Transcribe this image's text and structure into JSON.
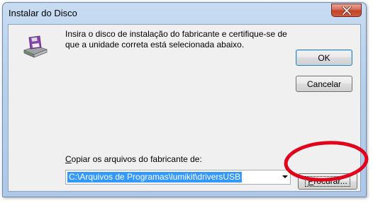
{
  "window": {
    "title": "Instalar do Disco"
  },
  "message": {
    "text": "Insira o disco de instalação do fabricante e certifique-se de que a unidade correta está selecionada abaixo."
  },
  "buttons": {
    "ok_label": "OK",
    "cancel_label": "Cancelar",
    "browse_prefix": "P",
    "browse_rest": "rocurar..."
  },
  "copy_from": {
    "label_prefix": "C",
    "label_rest": "opiar os arquivos do fabricante de:",
    "path_value": "C:\\Arquivos de Programas\\lumikit\\driversUSB"
  },
  "icons": {
    "disk": "floppy-disk-drive-icon",
    "close": "close-icon",
    "dropdown": "chevron-down-icon"
  },
  "colors": {
    "close_button": "#c9482d",
    "selection": "#3399ff",
    "annotation": "#e3001b"
  }
}
